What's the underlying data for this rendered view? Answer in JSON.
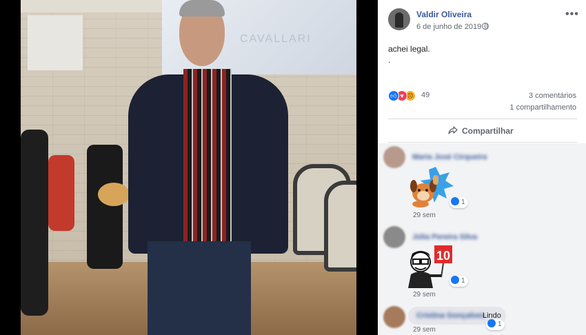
{
  "post": {
    "author": "Valdir Oliveira",
    "date": "6 de junho de 2019",
    "text": "achei legal.",
    "extra_line": ".",
    "reaction_count": "49",
    "comments_count": "3 comentários",
    "shares_count": "1 compartilhamento",
    "share_label": "Compartilhar",
    "photo_screen_text": "CAVALLARI"
  },
  "reactions": [
    "like-icon",
    "love-icon",
    "sad-icon"
  ],
  "comments": [
    {
      "name": "Maria José Cirqueira",
      "text": "",
      "sticker": "dog-thumbs-up-sticker",
      "likes": "1",
      "time": "29 sem"
    },
    {
      "name": "Júlia Pereira Silva",
      "text": "",
      "sticker": "glasses-guy-10-sign-sticker",
      "likes": "1",
      "time": "29 sem"
    },
    {
      "name": "Cristina Gonçalves",
      "text": "Lindo",
      "sticker": "",
      "likes": "1",
      "time": "29 sem"
    }
  ],
  "colors": {
    "link": "#385898",
    "meta": "#606770",
    "comments_bg": "#f2f3f5",
    "like_blue": "#1877f2"
  }
}
